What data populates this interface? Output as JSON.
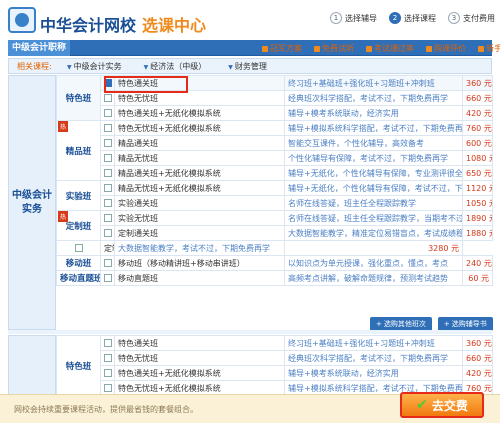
{
  "brand": {
    "name": "中华会计网校",
    "title": "选课中心"
  },
  "steps": [
    {
      "num": "1",
      "label": "选择辅导"
    },
    {
      "num": "2",
      "label": "选择课程"
    },
    {
      "num": "3",
      "label": "支付费用"
    }
  ],
  "section_tab": "中级会计职称",
  "top_links": [
    "冠军方案",
    "免费试听",
    "考试通过率",
    "购课评价",
    "新手指南"
  ],
  "filters": {
    "label": "相关课程:",
    "items": [
      "中级会计实务",
      "经济法（中级）",
      "财务管理"
    ]
  },
  "category_label": "中级会计实务",
  "rows": [
    {
      "group": "特色班",
      "group_rows": 3,
      "badge": false,
      "checked": true,
      "name": "特色通关班",
      "desc": "终习班+基础班+强化班+习题班+冲刺班",
      "price": "360 元"
    },
    {
      "checked": false,
      "name": "特色无忧班",
      "desc": "经典班次科学搭配，考试不过，下期免费再学",
      "price": "660 元"
    },
    {
      "checked": false,
      "name": "特色通关班+无纸化模拟系统",
      "desc": "辅导+模考系统联动，经济实用",
      "price": "420 元"
    },
    {
      "group": "精品班",
      "group_rows": 4,
      "badge": true,
      "checked": false,
      "name": "特色无忧班+无纸化模拟系统",
      "desc": "辅导+模拟系统科学搭配，考试不过，下期免费再学",
      "price": "760 元"
    },
    {
      "checked": false,
      "name": "精品通关班",
      "desc": "智能交互课件，个性化辅导，高效备考",
      "price": "600 元"
    },
    {
      "checked": false,
      "name": "精品无忧班",
      "desc": "个性化辅导有保障，考试不过，下期免费再学",
      "price": "1080 元"
    },
    {
      "checked": false,
      "name": "精品通关班+无纸化模拟系统",
      "desc": "辅导+无纸化，个性化辅导有保障，专业测评很全面",
      "price": "650 元"
    },
    {
      "group": "实验班",
      "group_rows": 2,
      "badge": false,
      "checked": false,
      "name": "精品无忧班+无纸化模拟系统",
      "desc": "辅导+无纸化，个性化辅导有保障，考试不过，下期免费再学",
      "price": "1120 元"
    },
    {
      "checked": false,
      "name": "实验通关班",
      "desc": "名师在线答疑，班主任全程跟踪教学",
      "price": "1050 元"
    },
    {
      "group": "定制班",
      "group_rows": 2,
      "badge": true,
      "checked": false,
      "name": "实验无忧班",
      "desc": "名师在线答疑，班主任全程跟踪教学，当期考不过下期免费再学",
      "price": "1890 元"
    },
    {
      "checked": false,
      "name": "定制通关班",
      "desc": "大数据智能教学，精准定位易错盲点，考试成绩稳步提升",
      "price": "1880 元"
    },
    {
      "checked": false,
      "name": "定制无忧班",
      "desc": "大数据智能教学，考试不过，下期免费再学",
      "price": "3280 元"
    },
    {
      "group": "移动班",
      "group_rows": 1,
      "badge": false,
      "checked": false,
      "name": "移动班（移动精讲班+移动串讲班）",
      "desc": "以知识点为单元授课，强化重点，懂点，考点",
      "price": "240 元"
    },
    {
      "group": "移动直题班",
      "group_rows": 1,
      "badge": false,
      "checked": false,
      "name": "移动直题班",
      "desc": "高频考点讲解，破解命题规律，预测考试趋势",
      "price": "60 元"
    }
  ],
  "buttons": [
    "选购其他班次",
    "选购辅导书"
  ],
  "rows2": [
    {
      "group": "特色班",
      "group_rows": 4,
      "checked": false,
      "name": "特色通关班",
      "desc": "终习班+基础班+强化班+习题班+冲刺班",
      "price": "360 元"
    },
    {
      "checked": false,
      "name": "特色无忧班",
      "desc": "经典班次科学搭配，考试不过，下期免费再学",
      "price": "660 元"
    },
    {
      "checked": false,
      "name": "特色通关班+无纸化模拟系统",
      "desc": "辅导+模考系统联动，经济实用",
      "price": "420 元"
    },
    {
      "checked": false,
      "name": "特色无忧班+无纸化模拟系统",
      "desc": "辅导+模拟系统科学搭配，考试不过，下期免费再学",
      "price": "760 元"
    }
  ],
  "footer_note": "网校会持续重要课程活动，提供最省钱的套餐组合。",
  "submit_label": "去交费",
  "colors": {
    "brand_blue": "#2f6fb8",
    "accent_orange": "#f08a1c",
    "price_red": "#d2381a",
    "highlight_red": "#e52a1a"
  }
}
